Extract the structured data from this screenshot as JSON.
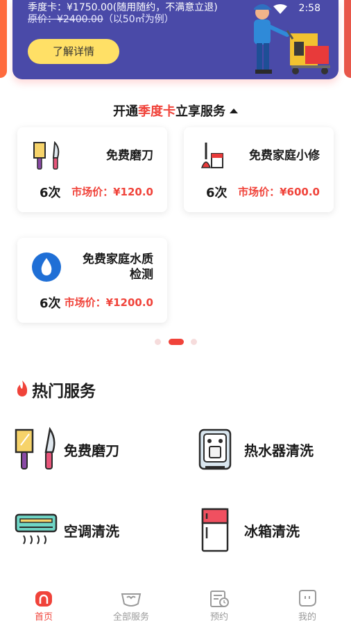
{
  "status_bar": {
    "time": "2:58"
  },
  "banner": {
    "line1": "季度卡：¥1750.00(随用随约，不满意立退)",
    "line2_strike": "原价：¥2400.00",
    "line2_rest": "（以50㎡为例）",
    "button_label": "了解详情"
  },
  "section": {
    "title_prefix": "开通",
    "title_highlight": "季度卡",
    "title_suffix": "立享服务"
  },
  "benefits": [
    {
      "title": "免费磨刀",
      "count": "6次",
      "price": "市场价：¥120.0"
    },
    {
      "title": "免费家庭小修",
      "count": "6次",
      "price": "市场价：¥600.0"
    },
    {
      "title_line1": "免费家庭水质",
      "title_line2": "检测",
      "count": "6次",
      "price": "市场价：¥1200.0"
    }
  ],
  "pager": {
    "count": 3,
    "active": 1
  },
  "hot": {
    "title": "热门服务",
    "items": [
      {
        "label": "免费磨刀",
        "icon": "knives-icon"
      },
      {
        "label": "热水器清洗",
        "icon": "water-heater-icon"
      },
      {
        "label": "空调清洗",
        "icon": "air-conditioner-icon"
      },
      {
        "label": "冰箱清洗",
        "icon": "fridge-icon"
      }
    ]
  },
  "tabs": [
    {
      "label": "首页",
      "icon": "home-icon",
      "active": true
    },
    {
      "label": "全部服务",
      "icon": "heart-bag-icon",
      "active": false
    },
    {
      "label": "预约",
      "icon": "calendar-clock-icon",
      "active": false
    },
    {
      "label": "我的",
      "icon": "profile-icon",
      "active": false
    }
  ],
  "colors": {
    "accent": "#f0433a",
    "banner_bg": "#4a4aa8",
    "button_yellow": "#ffe066"
  }
}
